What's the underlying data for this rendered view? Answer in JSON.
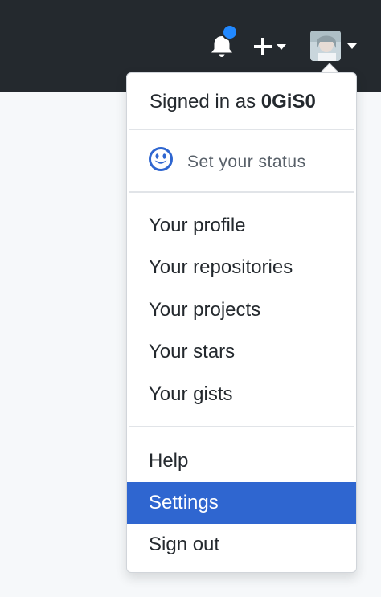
{
  "header": {
    "notifications_icon": "bell-icon",
    "create_icon": "plus-icon",
    "avatar_icon": "avatar-icon",
    "bg_color": "#24292e",
    "notification_dot_color": "#2188ff"
  },
  "dropdown": {
    "signed_in_prefix": "Signed in as ",
    "username": "0GiS0",
    "status": {
      "icon": "smiley-icon",
      "label": "Set your status"
    },
    "menu_group_1": [
      {
        "label": "Your profile"
      },
      {
        "label": "Your repositories"
      },
      {
        "label": "Your projects"
      },
      {
        "label": "Your stars"
      },
      {
        "label": "Your gists"
      }
    ],
    "menu_group_2": [
      {
        "label": "Help"
      },
      {
        "label": "Settings",
        "active": true
      },
      {
        "label": "Sign out"
      }
    ],
    "active_color": "#2f66d0"
  }
}
